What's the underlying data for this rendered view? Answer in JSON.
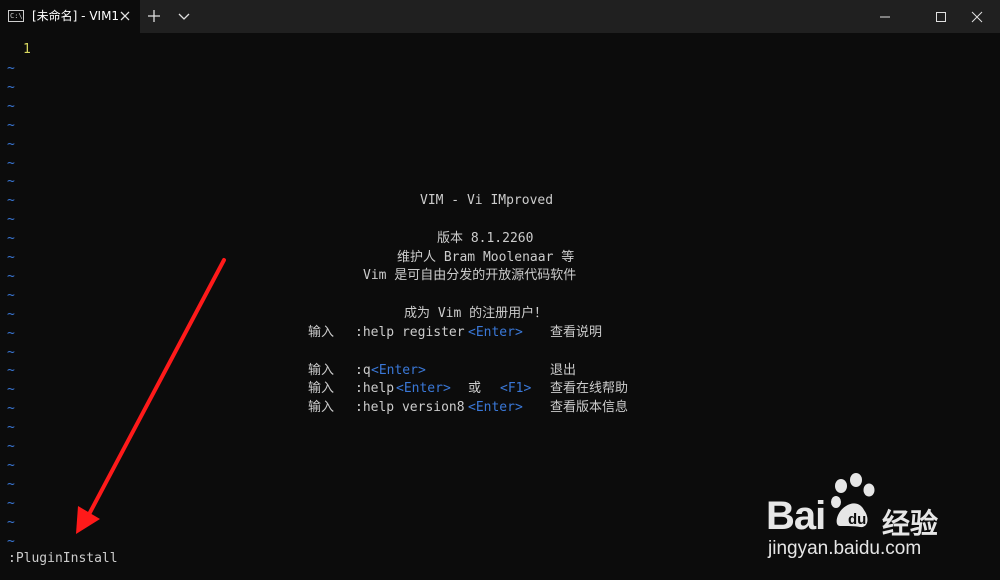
{
  "titlebar": {
    "tab_icon_text": "C:\\",
    "tab_title": "[未命名] - VIM1",
    "icons": [
      "terminal-icon",
      "close-icon",
      "plus-icon",
      "chevron-down-icon",
      "minimize-icon",
      "maximize-icon",
      "close-icon"
    ]
  },
  "editor": {
    "line_number": "1",
    "tilde": "~",
    "colors": {
      "line_number": "#d7d75f",
      "tilde": "#3a78d8",
      "key": "#3a78d8",
      "text": "#cccccc",
      "background": "#0c0c0c"
    },
    "intro": {
      "title": "VIM - Vi IMproved",
      "version": "版本 8.1.2260",
      "maintainer": "维护人 Bram Moolenaar 等",
      "distribution": "Vim 是可自由分发的开放源代码软件",
      "register_heading": "成为 Vim 的注册用户！",
      "register_line": {
        "prefix": "输入",
        "cmd": ":help register",
        "key": "<Enter>",
        "desc": "查看说明"
      },
      "quit_line": {
        "prefix": "输入",
        "cmd": ":q",
        "key": "<Enter>",
        "desc": "退出"
      },
      "help_line": {
        "prefix": "输入",
        "cmd": ":help",
        "key": "<Enter>",
        "or": "或",
        "key2": "<F1>",
        "desc": "查看在线帮助"
      },
      "version_line": {
        "prefix": "输入",
        "cmd": ":help version8",
        "key": "<Enter>",
        "desc": "查看版本信息"
      }
    }
  },
  "command_line": ":PluginInstall",
  "annotation": {
    "color": "#ff1a1a"
  },
  "watermark": {
    "brand": "Bai",
    "brand2": "经验",
    "url": "jingyan.baidu.com"
  }
}
